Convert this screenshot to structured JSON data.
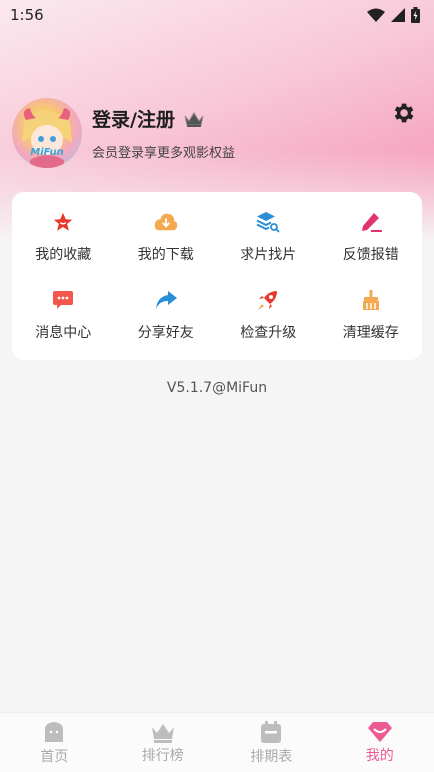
{
  "status_bar": {
    "time": "1:56"
  },
  "profile": {
    "avatar_text": "MiFun",
    "login_label": "登录/注册",
    "subtitle": "会员登录享更多观影权益"
  },
  "grid": [
    {
      "label": "我的收藏",
      "icon": "star-icon",
      "color": "#e8382b"
    },
    {
      "label": "我的下载",
      "icon": "cloud-download-icon",
      "color": "#f4a84f"
    },
    {
      "label": "求片找片",
      "icon": "layers-search-icon",
      "color": "#2b8fd6"
    },
    {
      "label": "反馈报错",
      "icon": "pencil-icon",
      "color": "#e0336f"
    },
    {
      "label": "消息中心",
      "icon": "message-icon",
      "color": "#f4564b"
    },
    {
      "label": "分享好友",
      "icon": "share-icon",
      "color": "#2b8fd6"
    },
    {
      "label": "检查升级",
      "icon": "rocket-icon",
      "color": "#e8382b"
    },
    {
      "label": "清理缓存",
      "icon": "broom-icon",
      "color": "#f4a84f"
    }
  ],
  "version": "V5.1.7@MiFun",
  "nav": [
    {
      "label": "首页",
      "icon": "home-icon"
    },
    {
      "label": "排行榜",
      "icon": "crown-icon"
    },
    {
      "label": "排期表",
      "icon": "calendar-icon"
    },
    {
      "label": "我的",
      "icon": "diamond-icon",
      "active": true
    }
  ],
  "colors": {
    "accent": "#ec5b93",
    "inactive": "#aaaaaa"
  }
}
